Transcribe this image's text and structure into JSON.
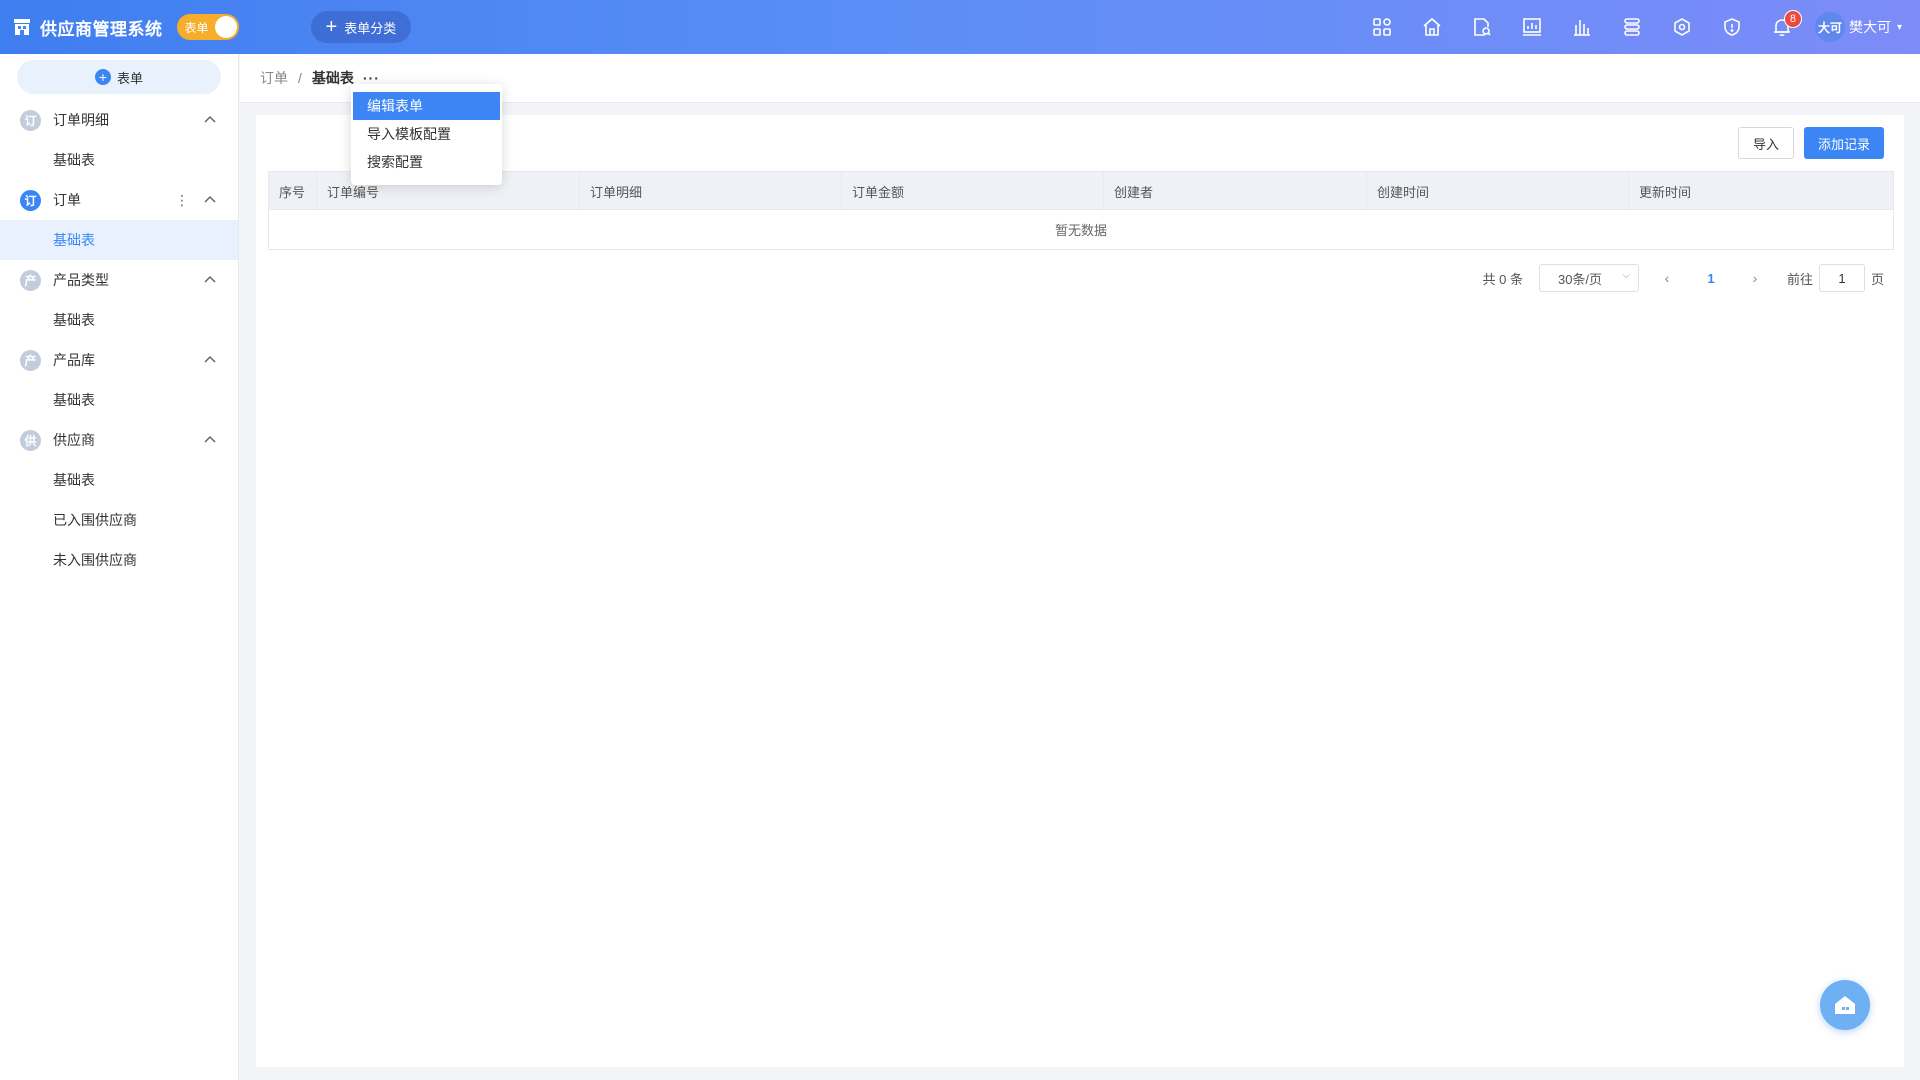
{
  "header": {
    "title": "供应商管理系统",
    "mode_toggle_label": "表单",
    "category_button_label": "表单分类",
    "notification_count": "8",
    "user_avatar_text": "大可",
    "user_name": "樊大可"
  },
  "sidebar": {
    "add_button_label": "表单",
    "groups": [
      {
        "icon_text": "订",
        "label": "订单明细",
        "items": [
          "基础表"
        ]
      },
      {
        "icon_text": "订",
        "label": "订单",
        "items": [
          "基础表"
        ]
      },
      {
        "icon_text": "产",
        "label": "产品类型",
        "items": [
          "基础表"
        ]
      },
      {
        "icon_text": "产",
        "label": "产品库",
        "items": [
          "基础表"
        ]
      },
      {
        "icon_text": "供",
        "label": "供应商",
        "items": [
          "基础表",
          "已入围供应商",
          "未入围供应商"
        ]
      }
    ]
  },
  "breadcrumb": {
    "parent": "订单",
    "separator": "/",
    "current": "基础表",
    "more": "···"
  },
  "dropdown": {
    "items": [
      "编辑表单",
      "导入模板配置",
      "搜索配置"
    ]
  },
  "toolbar": {
    "import_label": "导入",
    "add_label": "添加记录"
  },
  "table": {
    "columns": [
      "序号",
      "订单编号",
      "订单明细",
      "订单金额",
      "创建者",
      "创建时间",
      "更新时间"
    ],
    "empty_text": "暂无数据"
  },
  "pager": {
    "total_text": "共 0 条",
    "page_size": "30条/页",
    "current_page": "1",
    "goto_label": "前往",
    "goto_value": "1",
    "page_suffix": "页"
  },
  "colors": {
    "accent": "#3b85f5",
    "header_start": "#3f7ef0",
    "header_end": "#7c8cf8",
    "toggle": "#f6ad2c",
    "badge": "#f0483e"
  }
}
